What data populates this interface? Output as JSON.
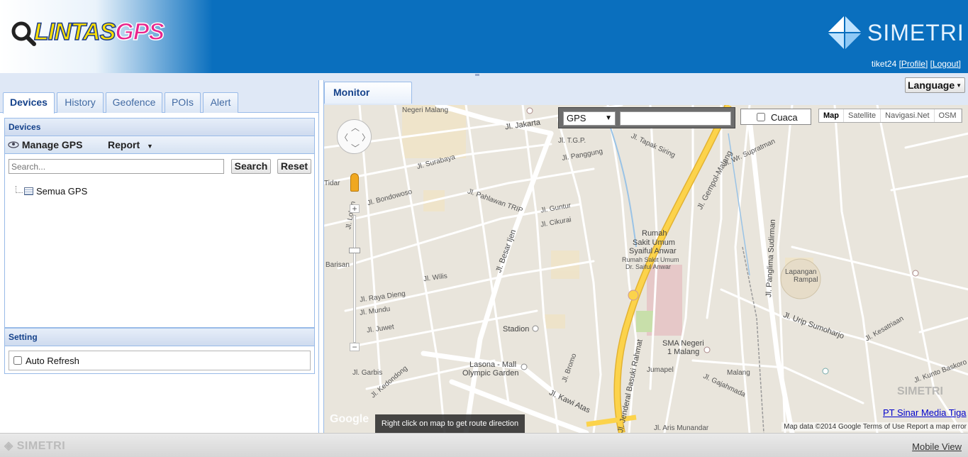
{
  "header": {
    "logo_word_a": "LINTAS",
    "logo_word_b": "GPS",
    "brand": "SIMETRI",
    "username": "tiket24",
    "profile_link": "[Profile]",
    "logout_link": "[Logout]"
  },
  "left_panel": {
    "tabs": [
      {
        "label": "Devices",
        "active": true
      },
      {
        "label": "History",
        "active": false
      },
      {
        "label": "Geofence",
        "active": false
      },
      {
        "label": "POIs",
        "active": false
      },
      {
        "label": "Alert",
        "active": false
      }
    ],
    "devices_title": "Devices",
    "manage_gps": "Manage GPS",
    "report": "Report",
    "search_placeholder": "Search...",
    "search_button": "Search",
    "reset_button": "Reset",
    "tree_root": "Semua GPS",
    "setting_title": "Setting",
    "auto_refresh": "Auto Refresh"
  },
  "right_panel": {
    "tab_label": "Monitor",
    "language_button": "Language",
    "gps_select_value": "GPS",
    "cuaca_label": "Cuaca",
    "map_types": [
      "Map",
      "Satellite",
      "Navigasi.Net",
      "OSM"
    ],
    "route_hint": "Right click on map to get route direction",
    "company_link": "PT Sinar Media Tiga",
    "watermark": "SIMETRI",
    "attribution": "Map data ©2014 Google    Terms of Use    Report a map error",
    "google": "Google"
  },
  "map_labels": {
    "negeri_malang": "Negeri Malang",
    "jakarta": "Jl. Jakarta",
    "tgp": "Jl. T.G.P.",
    "panggung": "Jl. Panggung",
    "tapak_siring": "Jl. Tapak Siring",
    "gempol": "Jl. Gempol-Malang",
    "supratman": "Jl. Wr. Supratman",
    "surabaya": "Jl. Surabaya",
    "bondowoso": "Jl. Bondowoso",
    "pahlawan": "Jl. Pahlawan TRIP",
    "besar_ijen": "Jl. Besar Ijen",
    "guntur": "Jl. Guntur",
    "cikurai": "Jl. Cikurai",
    "rsu_1": "Rumah",
    "rsu_2": "Sakit Umum",
    "rsu_3": "Syaiful Anwar",
    "rsu_4": "Rumah Sakit Umum",
    "rsu_5": "Dr. Saiful Anwar",
    "panglima": "Jl. Panglima Sudirman",
    "lapangan_1": "Lapangan",
    "lapangan_2": "Rampal",
    "urip": "Jl. Urip Sumoharjo",
    "wilis": "Jl. Wilis",
    "raya_dieng": "Jl. Raya Dieng",
    "mundu": "Jl. Mundu",
    "juwet": "Jl. Juwet",
    "stadion": "Stadion",
    "sma_1": "SMA Negeri",
    "sma_2": "1 Malang",
    "lasona_1": "Lasona - Mall",
    "lasona_2": "Olympic Garden",
    "bromo": "Jl. Bromo",
    "kawi": "Jl. Kawi Atas",
    "basuki": "Jl. Jenderal Basuki Rahmat",
    "jumapel": "Jumapel",
    "malang": "Malang",
    "gajahmada": "Jl. Gajahmada",
    "kesatriaan": "Jl. Kesatriaan",
    "kunto": "Jl. Kunto Baskoro",
    "garbis": "Jl. Garbis",
    "kedondong": "Jl. Kedondong",
    "aris_munandar": "Jl. Aris Munandar",
    "tidar": "Tidar",
    "barisan": "Barisan",
    "lokon": "Jl. Lokon"
  }
}
